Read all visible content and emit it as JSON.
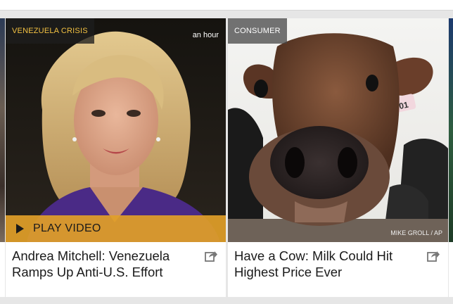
{
  "cards": [
    {
      "tag": "VENEZUELA CRISIS",
      "time": "an hour",
      "play_label": "PLAY VIDEO",
      "headline": "Andrea Mitchell: Venezuela Ramps Up Anti-U.S. Effort",
      "share_icon": "share-icon",
      "play_icon": "play-icon"
    },
    {
      "tag": "CONSUMER",
      "credit": "MIKE GROLL / AP",
      "headline": "Have a Cow: Milk Could Hit Highest Price Ever",
      "ear_tag": "601",
      "share_icon": "share-icon"
    }
  ],
  "colors": {
    "tag_text_1": "#f2c042",
    "play_bar": "#e1a028",
    "background": "#e6e6e6"
  }
}
